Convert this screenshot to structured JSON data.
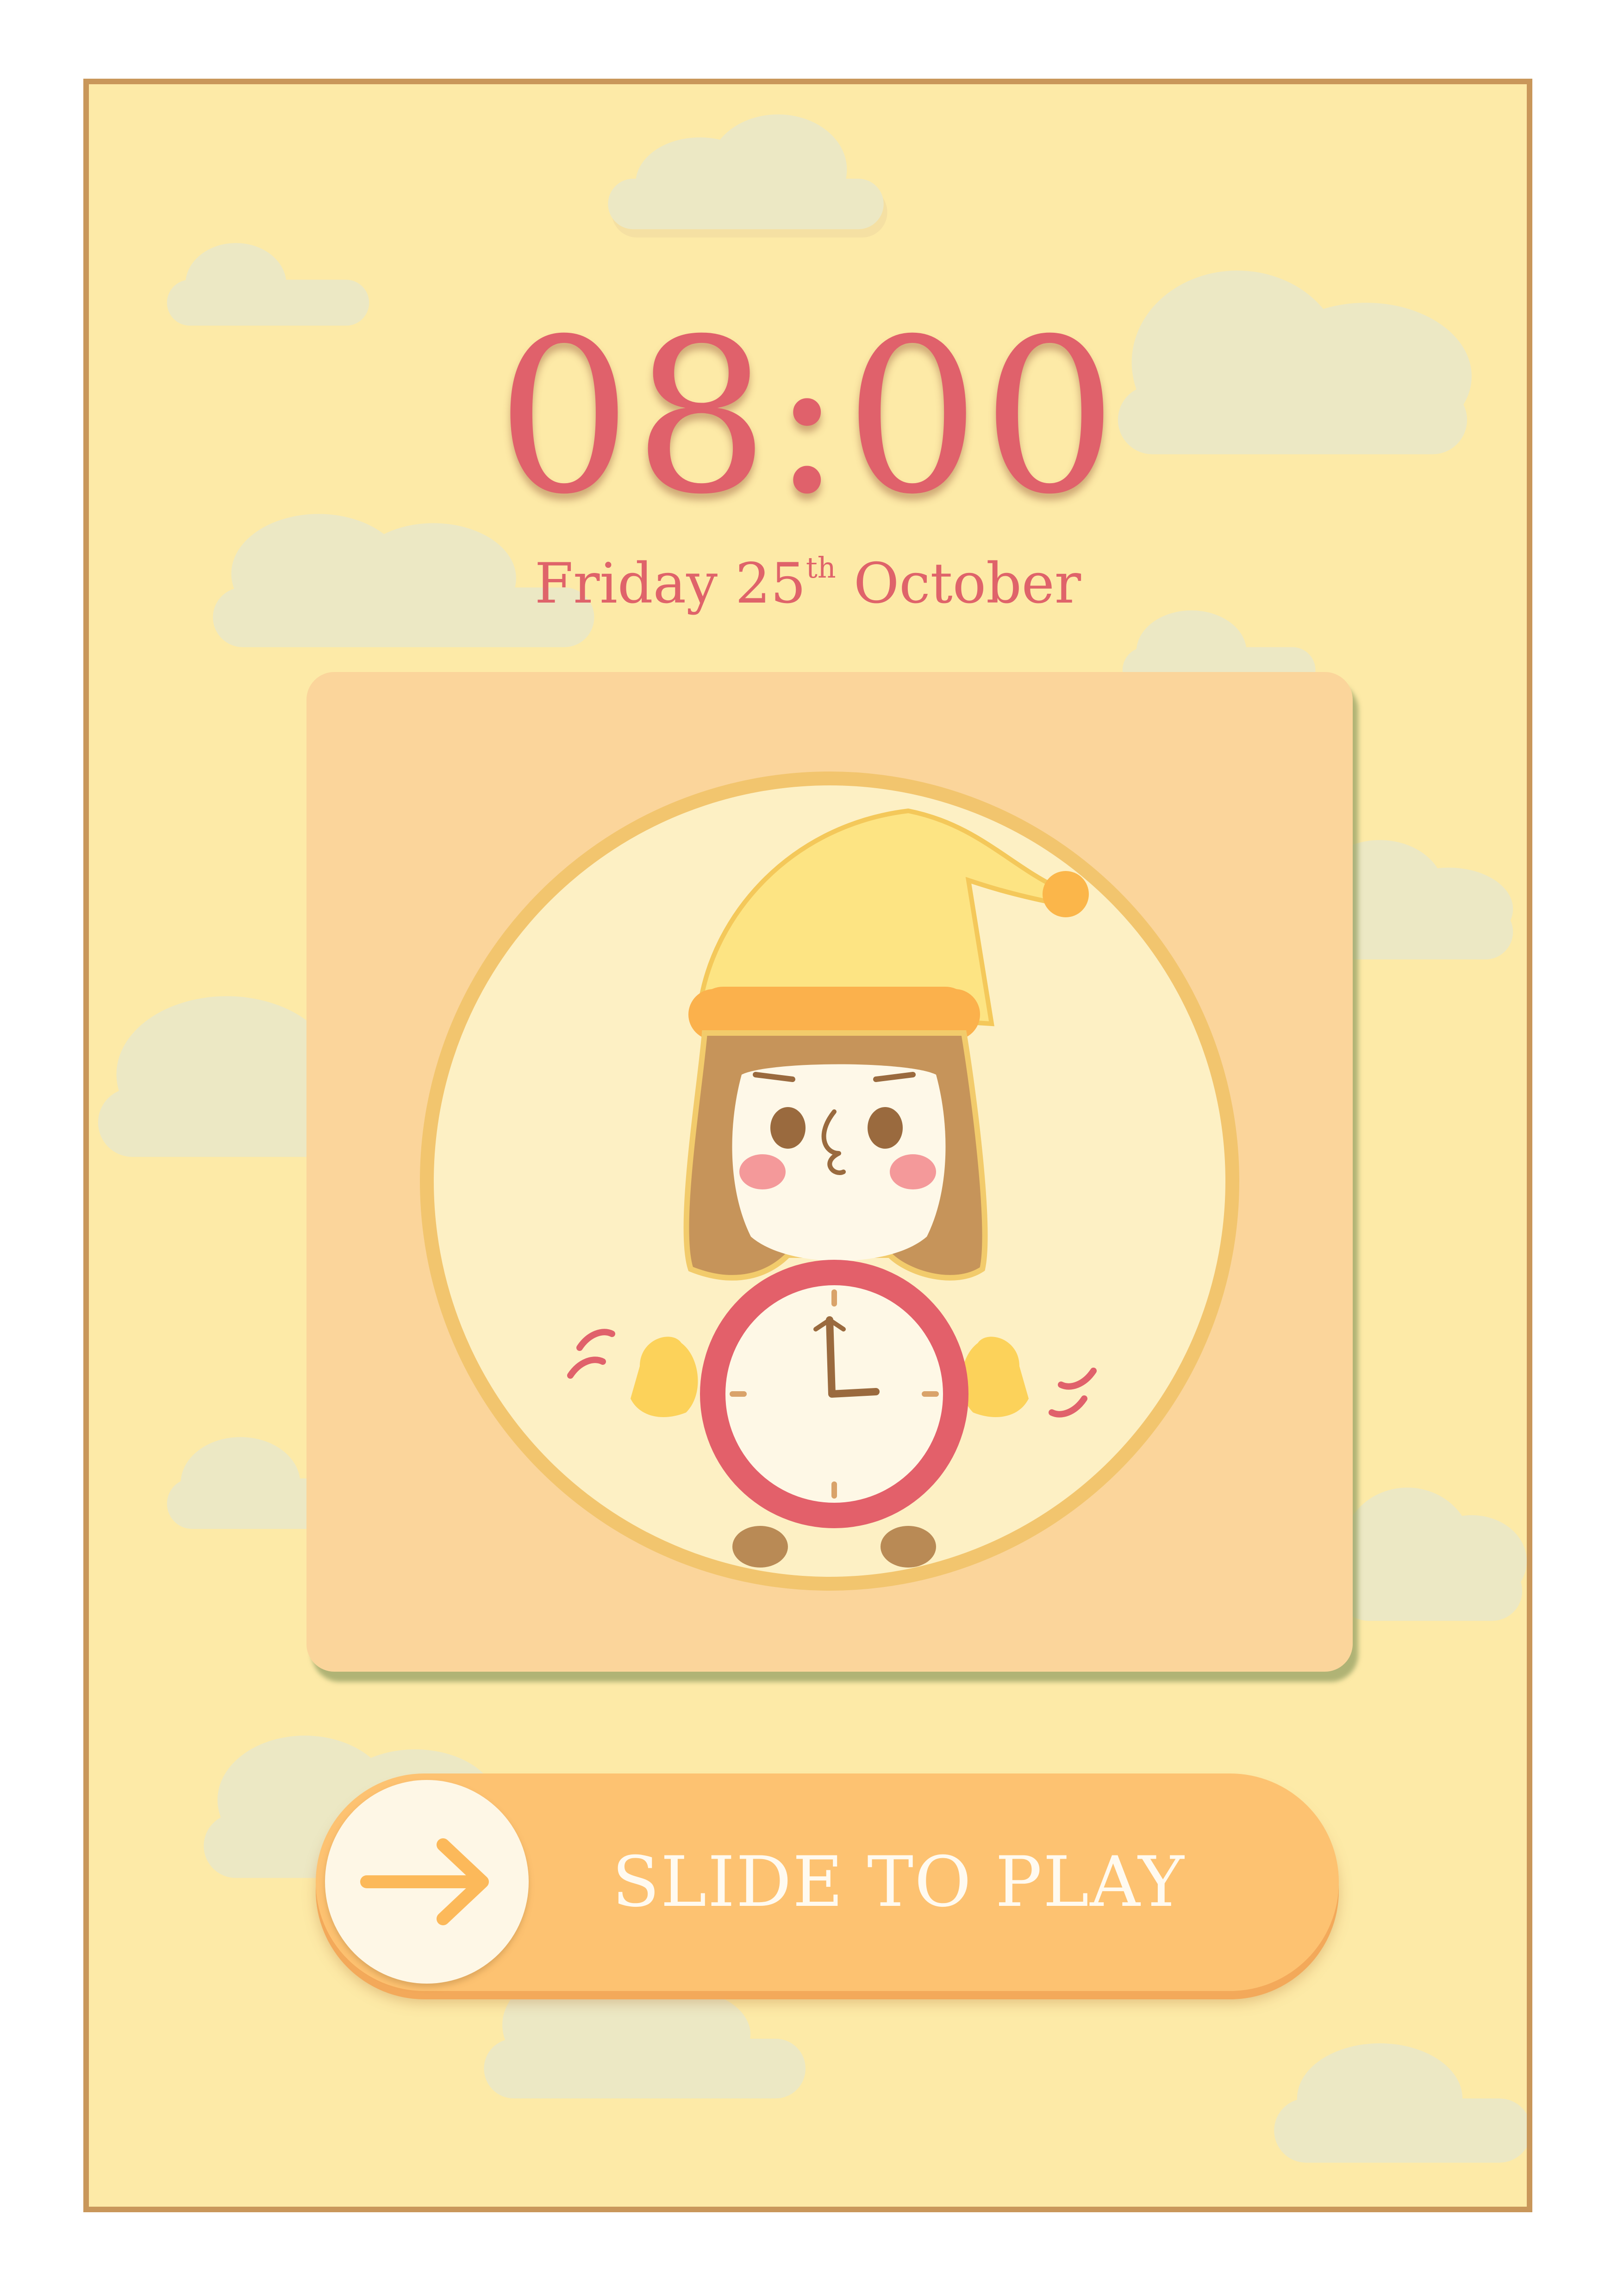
{
  "lockscreen": {
    "time": "08:00",
    "date": {
      "weekday": "Friday",
      "day": "25",
      "ordinal": "th",
      "month": "October"
    }
  },
  "slider": {
    "label": "SLIDE TO PLAY",
    "icon": "arrow-right-icon"
  },
  "illustration": {
    "subject": "girl-with-nightcap-alarm-clock"
  },
  "colors": {
    "background": "#fdeaa7",
    "border": "#c9975a",
    "time_text": "#e0616b",
    "card": "#fbd59b",
    "slider": "#fdc271",
    "clouds": "#ece8c4"
  }
}
